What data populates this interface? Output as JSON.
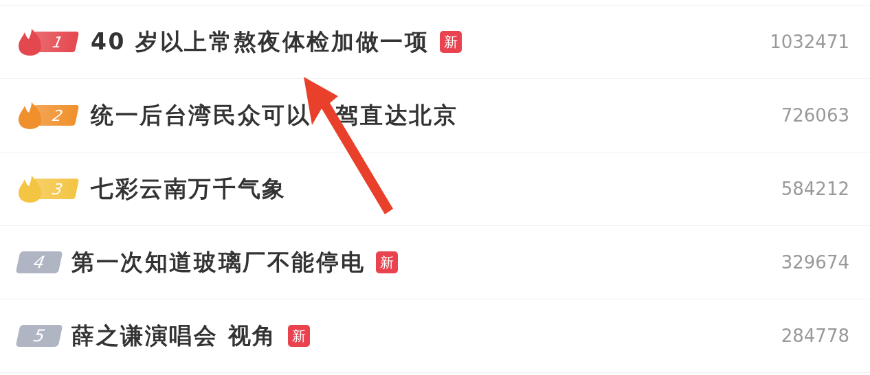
{
  "hot_list": [
    {
      "kind": "hot",
      "rank": "1",
      "color": "#e4484f",
      "title": "40 岁以上常熬夜体检加做一项",
      "new_tag": "新",
      "count": "1032471"
    },
    {
      "kind": "hot",
      "rank": "2",
      "color": "#f0902c",
      "title_parts": [
        "统一后台湾民众可以",
        "驾直达北京"
      ],
      "count": "726063"
    },
    {
      "kind": "hot",
      "rank": "3",
      "color": "#f4c443",
      "title": "七彩云南万千气象",
      "count": "584212"
    },
    {
      "kind": "plain",
      "rank": "4",
      "color": "#b0b5c4",
      "title": "第一次知道玻璃厂不能停电",
      "new_tag": "新",
      "count": "329674"
    },
    {
      "kind": "plain",
      "rank": "5",
      "color": "#b0b5c4",
      "title": "薛之谦演唱会 视角",
      "new_tag": "新",
      "count": "284778"
    }
  ]
}
